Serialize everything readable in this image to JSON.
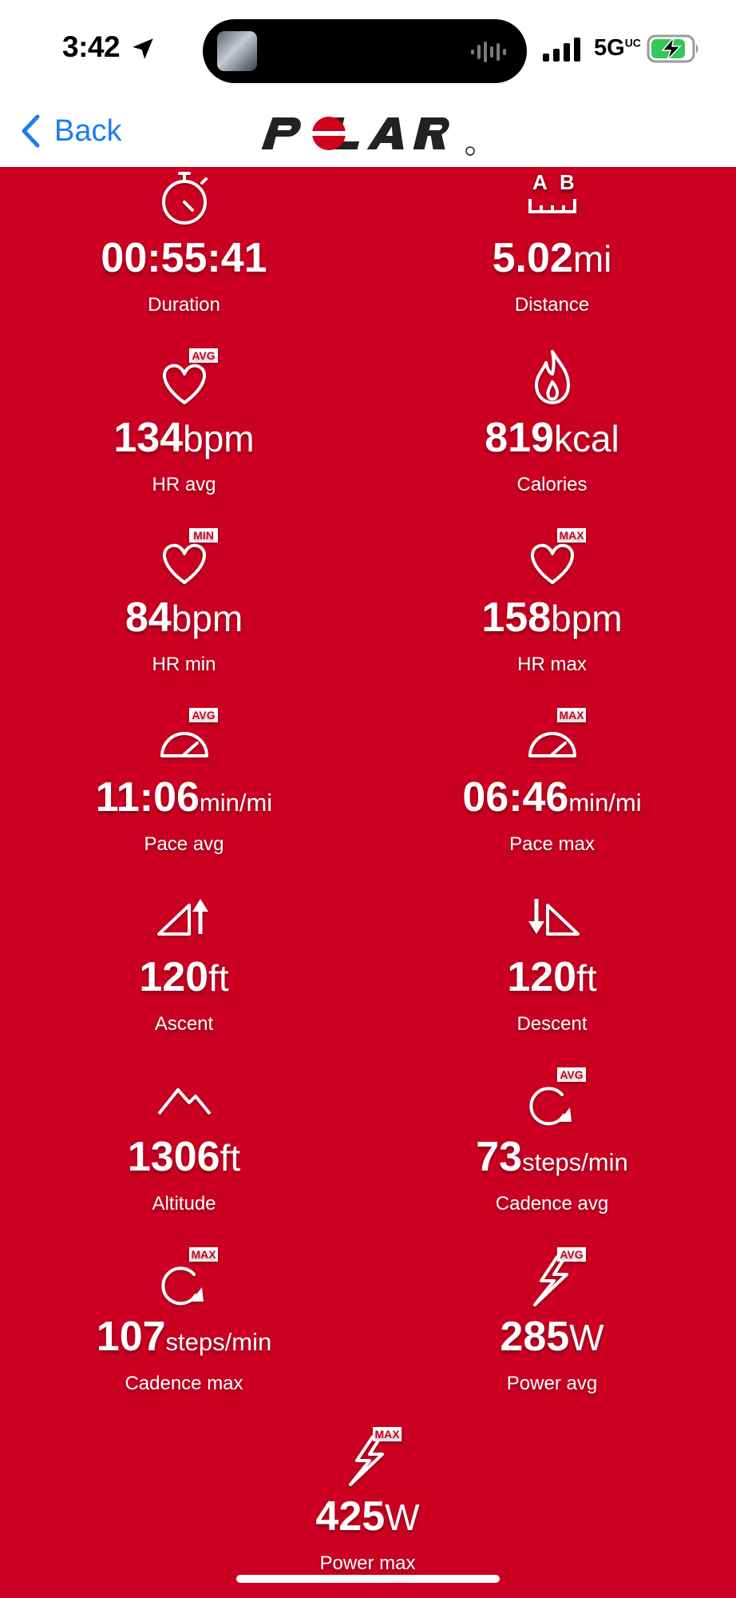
{
  "status_bar": {
    "time": "3:42",
    "network": "5G",
    "network_sup": "UC"
  },
  "nav": {
    "back_label": "Back",
    "logo_text": "POLAR"
  },
  "stats": [
    {
      "icon": "stopwatch-icon",
      "value": "00:55:41",
      "unit": "",
      "label": "Duration"
    },
    {
      "icon": "distance-icon",
      "value": "5.02",
      "unit": "mi",
      "label": "Distance"
    },
    {
      "icon": "heart-avg-icon",
      "value": "134",
      "unit": "bpm",
      "label": "HR avg"
    },
    {
      "icon": "flame-icon",
      "value": "819",
      "unit": "kcal",
      "label": "Calories"
    },
    {
      "icon": "heart-min-icon",
      "value": "84",
      "unit": "bpm",
      "label": "HR min"
    },
    {
      "icon": "heart-max-icon",
      "value": "158",
      "unit": "bpm",
      "label": "HR max"
    },
    {
      "icon": "speedometer-avg-icon",
      "value": "11:06",
      "unit": "min/mi",
      "label": "Pace avg"
    },
    {
      "icon": "speedometer-max-icon",
      "value": "06:46",
      "unit": "min/mi",
      "label": "Pace max"
    },
    {
      "icon": "ascent-icon",
      "value": "120",
      "unit": "ft",
      "label": "Ascent"
    },
    {
      "icon": "descent-icon",
      "value": "120",
      "unit": "ft",
      "label": "Descent"
    },
    {
      "icon": "mountain-icon",
      "value": "1306",
      "unit": "ft",
      "label": "Altitude"
    },
    {
      "icon": "cadence-avg-icon",
      "value": "73",
      "unit": "steps/min",
      "label": "Cadence avg"
    },
    {
      "icon": "cadence-max-icon",
      "value": "107",
      "unit": "steps/min",
      "label": "Cadence max"
    },
    {
      "icon": "power-avg-icon",
      "value": "285",
      "unit": "W",
      "label": "Power avg"
    },
    {
      "icon": "power-max-icon",
      "value": "425",
      "unit": "W",
      "label": "Power max"
    }
  ],
  "badges": {
    "avg": "AVG",
    "min": "MIN",
    "max": "MAX",
    "a": "A",
    "b": "B"
  },
  "colors": {
    "content_bg": "#cc0022",
    "back_blue": "#1c7cf4",
    "battery_green": "#35c759"
  }
}
